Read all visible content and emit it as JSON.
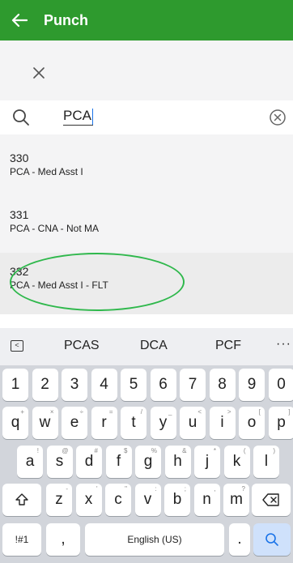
{
  "header": {
    "back_icon": "arrow-left-icon",
    "title": "Punch"
  },
  "close_icon": "close-icon",
  "search": {
    "value": "PCA",
    "search_icon": "search-icon",
    "clear_icon": "clear-circle-icon"
  },
  "results": [
    {
      "code": "330",
      "name": "PCA - Med Asst I"
    },
    {
      "code": "331",
      "name": "PCA - CNA - Not MA"
    },
    {
      "code": "332",
      "name": "PCA - Med Asst I - FLT"
    }
  ],
  "suggestions": [
    "PCAS",
    "DCA",
    "PCF"
  ],
  "suggestion_more": "···",
  "keyboard": {
    "numbers": [
      "1",
      "2",
      "3",
      "4",
      "5",
      "6",
      "7",
      "8",
      "9",
      "0"
    ],
    "row1": [
      [
        "q",
        "+"
      ],
      [
        "w",
        "×"
      ],
      [
        "e",
        "÷"
      ],
      [
        "r",
        "="
      ],
      [
        "t",
        "/"
      ],
      [
        "y",
        "_"
      ],
      [
        "u",
        "<"
      ],
      [
        "i",
        ">"
      ],
      [
        "o",
        "["
      ],
      [
        "p",
        "]"
      ]
    ],
    "row2": [
      [
        "a",
        "!"
      ],
      [
        "s",
        "@"
      ],
      [
        "d",
        "#"
      ],
      [
        "f",
        "$"
      ],
      [
        "g",
        "%"
      ],
      [
        "h",
        "&"
      ],
      [
        "j",
        "*"
      ],
      [
        "k",
        "("
      ],
      [
        "l",
        ")"
      ]
    ],
    "row3": [
      [
        "z",
        "-"
      ],
      [
        "x",
        "'"
      ],
      [
        "c",
        "\""
      ],
      [
        "v",
        ":"
      ],
      [
        "b",
        ";"
      ],
      [
        "n",
        ","
      ],
      [
        "m",
        "?"
      ]
    ],
    "shift_icon": "shift-icon",
    "backspace_icon": "backspace-icon",
    "symbols_label": "!#1",
    "comma": ",",
    "space_label": "English (US)",
    "period": ".",
    "search_key_icon": "search-icon"
  },
  "colors": {
    "header_green": "#2e9a2e",
    "highlight_oval": "#2fb84c"
  }
}
